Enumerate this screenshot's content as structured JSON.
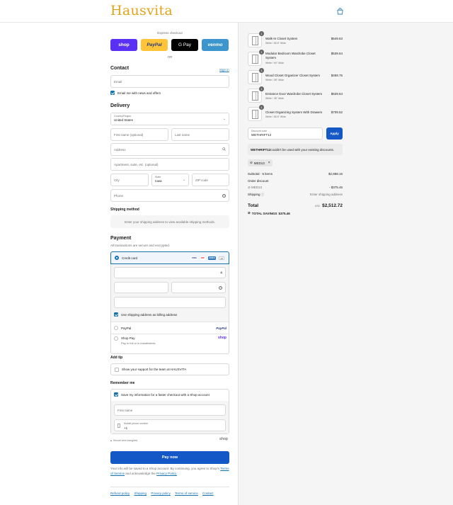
{
  "header": {
    "logo": "Hausvita",
    "cart_icon": "shopping-bag-icon"
  },
  "express": {
    "title": "Express checkout",
    "buttons": [
      {
        "label": "shop",
        "color": "#5a31f4"
      },
      {
        "label": "PayPal",
        "color": "#ffc439"
      },
      {
        "label": "G Pay",
        "color": "#000000"
      },
      {
        "label": "venmo",
        "color": "#3d95ce"
      }
    ],
    "or": "OR"
  },
  "contact": {
    "title": "Contact",
    "sign_in": "Sign in",
    "email_placeholder": "Email",
    "news_label": "Email me with news and offers"
  },
  "delivery": {
    "title": "Delivery",
    "country_label": "Country/Region",
    "country_value": "United States",
    "first_name": "First name (optional)",
    "last_name": "Last name",
    "address": "Address",
    "apartment": "Apartment, suite, etc. (optional)",
    "city": "City",
    "state_label": "State",
    "state_value": "Iowa",
    "zip": "ZIP code",
    "phone": "Phone"
  },
  "shipping": {
    "title": "Shipping method",
    "message": "Enter your shipping address to view available shipping methods."
  },
  "payment": {
    "title": "Payment",
    "subtitle": "All transactions are secure and encrypted.",
    "credit_card": "Credit card",
    "card_badges": [
      "VISA",
      "MC",
      "AMEX",
      "+3"
    ],
    "billing_label": "Use shipping address as billing address",
    "paypal": "PayPal",
    "paypal_logo": "PayPal",
    "shop_pay": "Shop Pay",
    "shop_pay_sub": "Pay in full or in installments",
    "shop_logo": "shop"
  },
  "tip": {
    "title": "Add tip",
    "label": "Show your support for the team at HAUSVITA"
  },
  "remember": {
    "title": "Remember me",
    "save_label": "Save my information for a faster checkout with a Shop account",
    "first_name": "First name",
    "mobile_label": "Mobile phone number",
    "mobile_value": "+1",
    "secure": "Secure and encrypted",
    "shop_logo": "shop"
  },
  "pay_now": "Pay now",
  "legal": {
    "text1": "Your info will be saved to a Shop account. By continuing, you agree to Shop's",
    "terms": "Terms of Service",
    "text2": "and acknowledge the",
    "privacy": "Privacy Policy."
  },
  "footer": [
    "Refund policy",
    "Shipping",
    "Privacy policy",
    "Terms of service",
    "Contact"
  ],
  "order": {
    "items": [
      {
        "qty": "1",
        "name": "Walk-In Closet System",
        "variant": "White / 56.5\" Wide",
        "price": "$549.63"
      },
      {
        "qty": "1",
        "name": "Modular Bedroom Wardrobe Closet System",
        "variant": "White / 94\" Wide",
        "price": "$539.64"
      },
      {
        "qty": "1",
        "name": "Wood Closet Organizer Closet System",
        "variant": "White / 38\" Wide",
        "price": "$459.75"
      },
      {
        "qty": "1",
        "name": "Entrance Door Wardrobe Closet System",
        "variant": "White / 38\" Wide",
        "price": "$629.64"
      },
      {
        "qty": "1",
        "name": "Closet Organizing System With Drawers",
        "variant": "White / 56.5\" Wide",
        "price": "$709.52"
      }
    ],
    "discount_label": "Discount code",
    "discount_value": "WETHRIFT12",
    "apply": "Apply",
    "error_code": "WETHRIFT12",
    "error_text": " couldn't be used with your existing discounts.",
    "tag": "MED13",
    "subtotal_label": "Subtotal · 5 items",
    "subtotal_value": "$2,888.16",
    "order_discount_label": "Order discount",
    "discount_code": "MED13",
    "discount_amount": "- $375.46",
    "shipping_label": "Shipping",
    "shipping_value": "Enter shipping address",
    "total_label": "Total",
    "currency": "USD",
    "total_value": "$2,512.72",
    "savings_label": "TOTAL SAVINGS",
    "savings_value": "$375.46"
  }
}
